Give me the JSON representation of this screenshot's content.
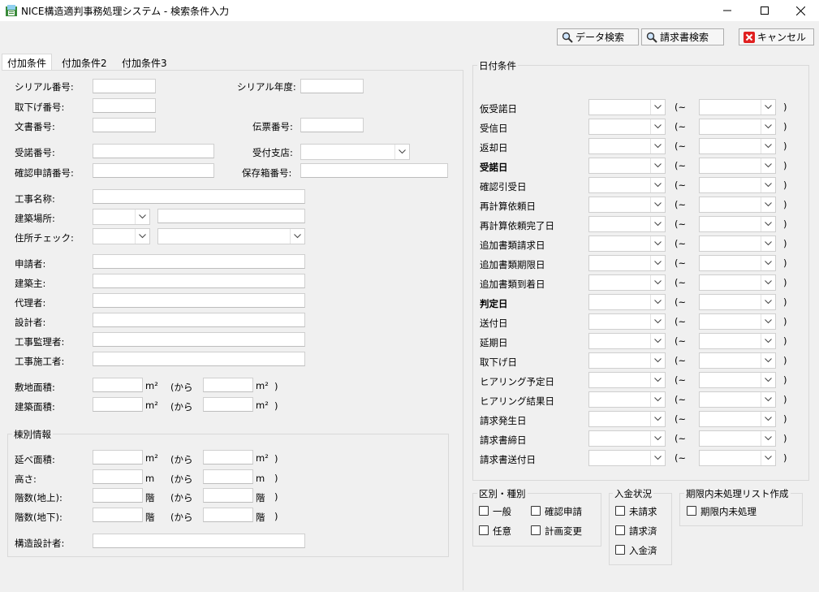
{
  "window": {
    "title": "NICE構造適判事務処理システム - 検索条件入力",
    "minimize": "—",
    "maximize": "☐",
    "close": "✕"
  },
  "toolbar": {
    "data_search": "データ検索",
    "invoice_search": "請求書検索",
    "cancel": "キャンセル"
  },
  "tabs": [
    "付加条件",
    "付加条件2",
    "付加条件3"
  ],
  "form": {
    "serial_no": "シリアル番号:",
    "serial_year": "シリアル年度:",
    "withdraw_no": "取下げ番号:",
    "doc_no": "文書番号:",
    "slip_no": "伝票番号:",
    "accept_no": "受諾番号:",
    "accept_branch": "受付支店:",
    "confirm_no": "確認申請番号:",
    "storage_no": "保存箱番号:",
    "work_name": "工事名称:",
    "build_place": "建築場所:",
    "address_check": "住所チェック:",
    "applicant": "申請者:",
    "owner": "建築主:",
    "agent": "代理者:",
    "designer": "設計者:",
    "supervisor": "工事監理者:",
    "contractor": "工事施工者:",
    "site_area": "敷地面積:",
    "build_area": "建築面積:",
    "unit_m2": "m²",
    "unit_m": "m",
    "unit_floor": "階",
    "from": "(から",
    "close_paren": ")"
  },
  "building": {
    "title": "棟別情報",
    "floor_area": "延べ面積:",
    "height": "高さ:",
    "floors_above": "階数(地上):",
    "floors_below": "階数(地下):",
    "struct_designer": "構造設計者:"
  },
  "date_conditions": {
    "title": "日付条件",
    "tilde": "(~",
    "close_paren": ")",
    "rows": [
      {
        "label": "仮受諾日",
        "bold": false
      },
      {
        "label": "受信日",
        "bold": false
      },
      {
        "label": "返却日",
        "bold": false
      },
      {
        "label": "受諾日",
        "bold": true
      },
      {
        "label": "確認引受日",
        "bold": false
      },
      {
        "label": "再計算依頼日",
        "bold": false
      },
      {
        "label": "再計算依頼完了日",
        "bold": false
      },
      {
        "label": "追加書類請求日",
        "bold": false
      },
      {
        "label": "追加書類期限日",
        "bold": false
      },
      {
        "label": "追加書類到着日",
        "bold": false
      },
      {
        "label": "判定日",
        "bold": true
      },
      {
        "label": "送付日",
        "bold": false
      },
      {
        "label": "延期日",
        "bold": false
      },
      {
        "label": "取下げ日",
        "bold": false
      },
      {
        "label": "ヒアリング予定日",
        "bold": false
      },
      {
        "label": "ヒアリング結果日",
        "bold": false
      },
      {
        "label": "請求発生日",
        "bold": false
      },
      {
        "label": "請求書締日",
        "bold": false
      },
      {
        "label": "請求書送付日",
        "bold": false
      }
    ]
  },
  "category": {
    "title": "区別・種別",
    "general": "一般",
    "confirm_apply": "確認申請",
    "optional": "任意",
    "plan_change": "計画変更"
  },
  "payment": {
    "title": "入金状況",
    "unbilled": "未請求",
    "billed": "請求済",
    "paid": "入金済"
  },
  "overdue": {
    "title": "期限内未処理リスト作成",
    "item": "期限内未処理"
  }
}
